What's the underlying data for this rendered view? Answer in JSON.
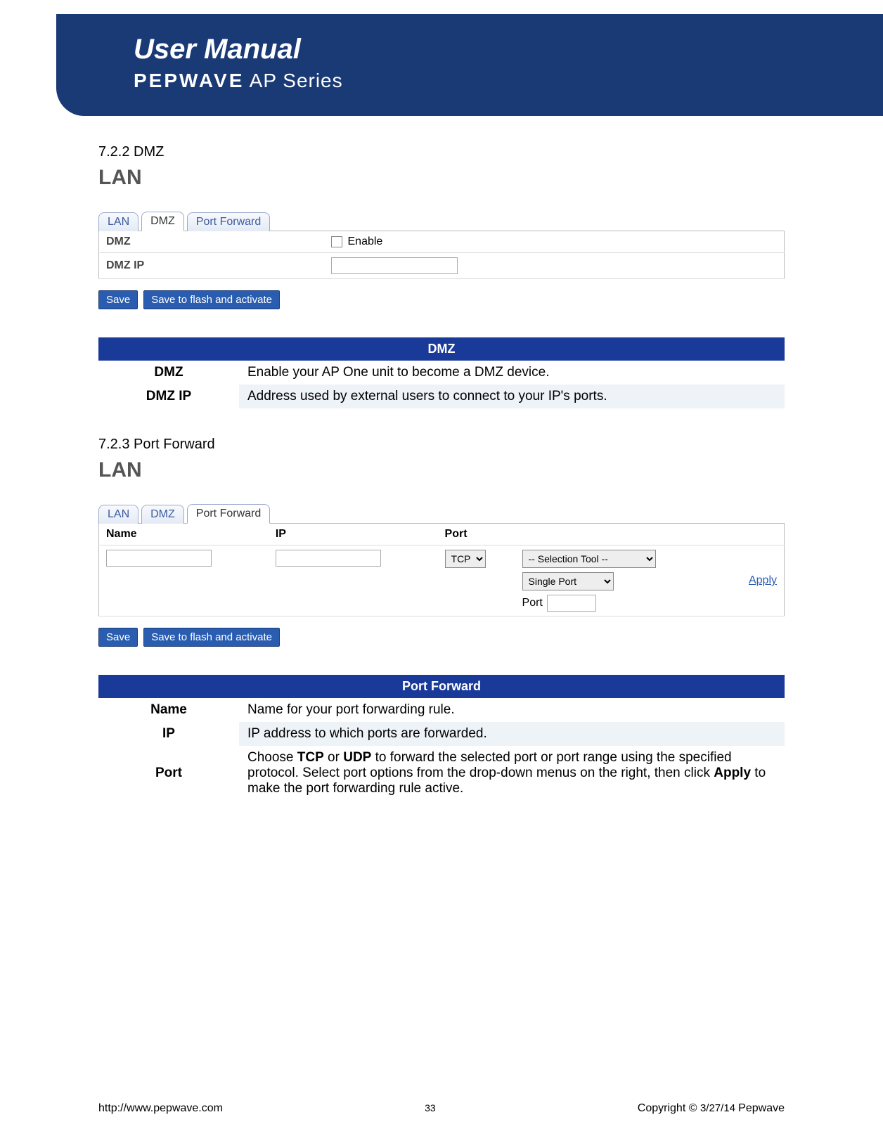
{
  "header": {
    "title": "User Manual",
    "brand_bold": "PEPWAVE",
    "brand_light": " AP Series"
  },
  "sections": {
    "dmz_num": "7.2.2 DMZ",
    "pf_num": "7.2.3 Port Forward",
    "lan_title": "LAN"
  },
  "tabs": {
    "lan": "LAN",
    "dmz": "DMZ",
    "pf": "Port Forward"
  },
  "dmz_ui": {
    "row1_label": "DMZ",
    "row1_enable": "Enable",
    "row2_label": "DMZ IP"
  },
  "buttons": {
    "save": "Save",
    "save_flash": "Save to flash and activate"
  },
  "dmz_def": {
    "header": "DMZ",
    "r1_term": "DMZ",
    "r1_desc": "Enable your AP One unit to become a DMZ device.",
    "r2_term": "DMZ IP",
    "r2_desc": "Address used by external users to connect to your IP's ports."
  },
  "pf_ui": {
    "col_name": "Name",
    "col_ip": "IP",
    "col_port": "Port",
    "sel_proto": "TCP",
    "sel_tool": "-- Selection Tool --",
    "sel_mode": "Single Port",
    "port_label": "Port",
    "apply": "Apply"
  },
  "pf_def": {
    "header": "Port Forward",
    "r1_term": "Name",
    "r1_desc": "Name for your port forwarding rule.",
    "r2_term": "IP",
    "r2_desc": "IP address to which ports are forwarded.",
    "r3_term": "Port",
    "r3_desc_a": "Choose ",
    "r3_desc_b": "TCP",
    "r3_desc_c": " or ",
    "r3_desc_d": "UDP",
    "r3_desc_e": " to forward the selected port or port range using the specified protocol. Select port options from the drop-down menus on the right, then click ",
    "r3_desc_f": "Apply",
    "r3_desc_g": " to make the port forwarding rule active."
  },
  "footer": {
    "url": "http://www.pepwave.com",
    "page": "33",
    "copyright_a": "Copyright © ",
    "copyright_b": "3/27/14 ",
    "copyright_c": "Pepwave"
  }
}
